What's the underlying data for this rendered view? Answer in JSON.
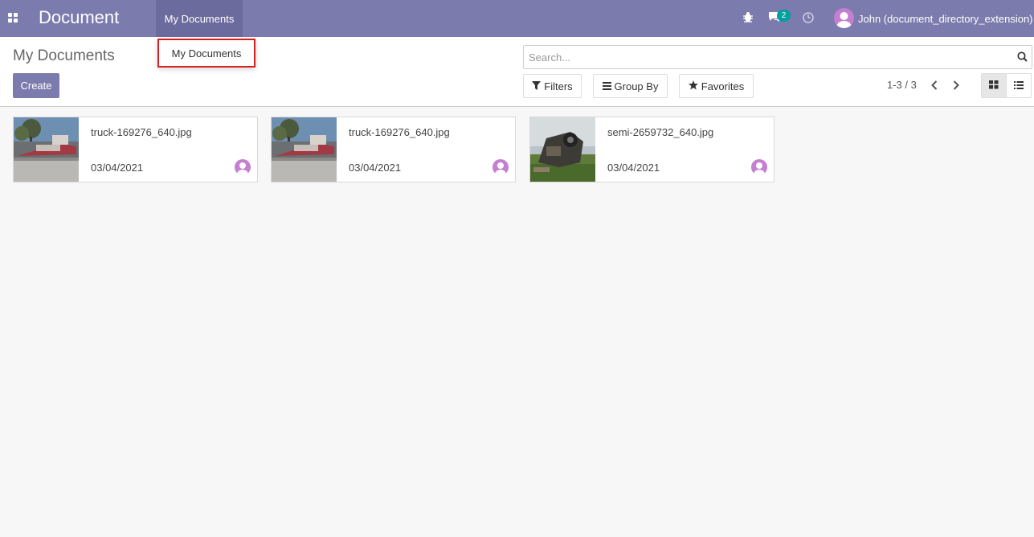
{
  "navbar": {
    "app_title": "Document",
    "menu_label": "My Documents",
    "dropdown_item": "My Documents",
    "chat_count": "2",
    "user_name": "John (document_directory_extension)"
  },
  "control_panel": {
    "title": "My Documents",
    "create_label": "Create",
    "search_placeholder": "Search...",
    "filters_label": "Filters",
    "groupby_label": "Group By",
    "favorites_label": "Favorites",
    "pager": "1-3 / 3"
  },
  "documents": [
    {
      "name": "truck-169276_640.jpg",
      "date": "03/04/2021"
    },
    {
      "name": "truck-169276_640.jpg",
      "date": "03/04/2021"
    },
    {
      "name": "semi-2659732_640.jpg",
      "date": "03/04/2021"
    }
  ],
  "colors": {
    "navbar": "#7c7bad",
    "active_menu": "#6c6b9d",
    "badge": "#00a09d",
    "avatar": "#c47fd1",
    "highlight_border": "#d62121"
  },
  "icons": {
    "apps": "apps-grid-icon",
    "bug": "bug-icon",
    "chat": "chat-icon",
    "activity": "clock-icon",
    "search": "search-icon",
    "filter": "filter-icon",
    "groupby": "bars-icon",
    "favorites": "star-icon",
    "kanban": "kanban-view-icon",
    "list": "list-view-icon"
  }
}
